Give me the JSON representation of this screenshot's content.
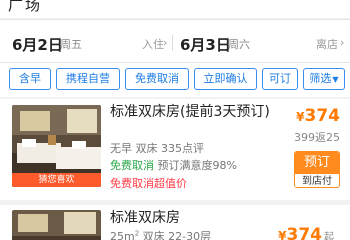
{
  "location": {
    "text": "广场"
  },
  "dates": {
    "checkin_date": "6月2日",
    "checkin_weekday": "周五",
    "checkin_label": "入住",
    "checkout_date": "6月3日",
    "checkout_weekday": "周六",
    "checkout_label": "离店"
  },
  "filters": [
    {
      "label": "含早"
    },
    {
      "label": "携程自营"
    },
    {
      "label": "免费取消"
    },
    {
      "label": "立即确认"
    },
    {
      "label": "可订"
    },
    {
      "label": "筛选"
    }
  ],
  "rooms": [
    {
      "title": "标准双床房(提前3天预订)",
      "meta_line1": "无早  双床  335点评",
      "free_cancel": "免费取消",
      "satisfaction": "预订满意度98%",
      "promo": "免费取消超值价",
      "badge": "猜您喜欢",
      "currency": "¥",
      "price": "374",
      "price_sub": "399返25",
      "book_label": "预订",
      "pay_label": "到店付"
    },
    {
      "title": "标准双床房",
      "area": "25m",
      "area_sup": "2",
      "meta_rest": " 双床 22-30层",
      "currency": "¥",
      "price": "374",
      "price_suffix": "起"
    }
  ],
  "colors": {
    "accent": "#1f7de6",
    "price": "#ff7a00",
    "green": "#2aa84a",
    "red": "#ff3b45",
    "badge": "#ff5a2c"
  }
}
